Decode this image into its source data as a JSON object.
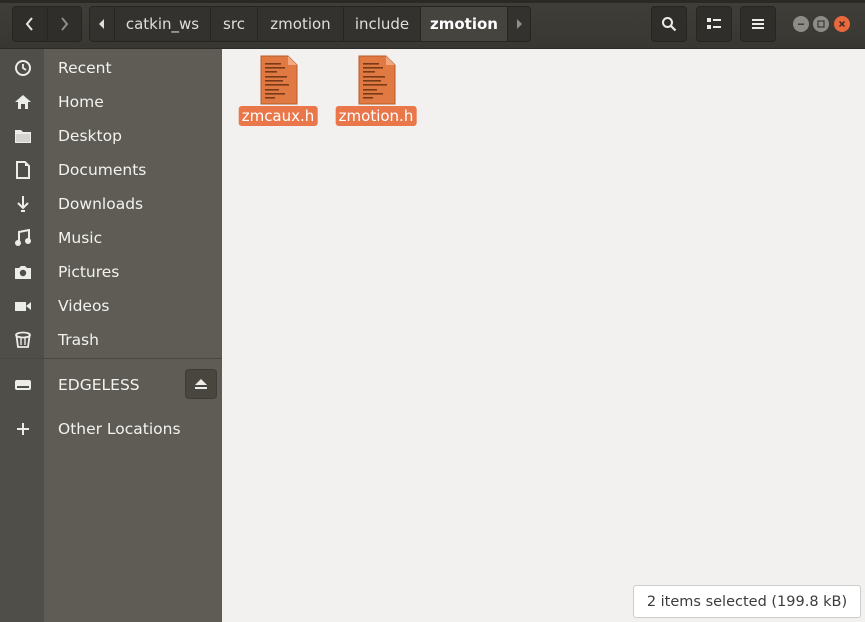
{
  "window": {
    "title": "zmotion"
  },
  "nav": {
    "back": "back",
    "forward": "forward"
  },
  "path": {
    "crumbs": [
      "catkin_ws",
      "src",
      "zmotion",
      "include",
      "zmotion"
    ],
    "active": "zmotion"
  },
  "toolbar": {
    "search": "search",
    "view": "view-list",
    "menu": "menu"
  },
  "window_buttons": [
    "minimize",
    "maximize",
    "close"
  ],
  "sidebar": {
    "items": [
      {
        "label": "Recent",
        "icon": "clock-icon"
      },
      {
        "label": "Home",
        "icon": "home-icon"
      },
      {
        "label": "Desktop",
        "icon": "folder-icon"
      },
      {
        "label": "Documents",
        "icon": "document-icon"
      },
      {
        "label": "Downloads",
        "icon": "download-icon"
      },
      {
        "label": "Music",
        "icon": "music-icon"
      },
      {
        "label": "Pictures",
        "icon": "camera-icon"
      },
      {
        "label": "Videos",
        "icon": "video-icon"
      },
      {
        "label": "Trash",
        "icon": "trash-icon"
      }
    ],
    "devices": [
      {
        "label": "EDGELESS",
        "icon": "drive-icon"
      }
    ],
    "other": {
      "label": "Other Locations",
      "icon": "plus-icon"
    }
  },
  "files": [
    {
      "name": "zmcaux.h",
      "selected": true
    },
    {
      "name": "zmotion.h",
      "selected": true
    }
  ],
  "status": {
    "text": "2 items selected  (199.8 kB)"
  },
  "colors": {
    "accent": "#e9774a",
    "sidebar": "#5e5c55",
    "header": "#3b3a36"
  }
}
